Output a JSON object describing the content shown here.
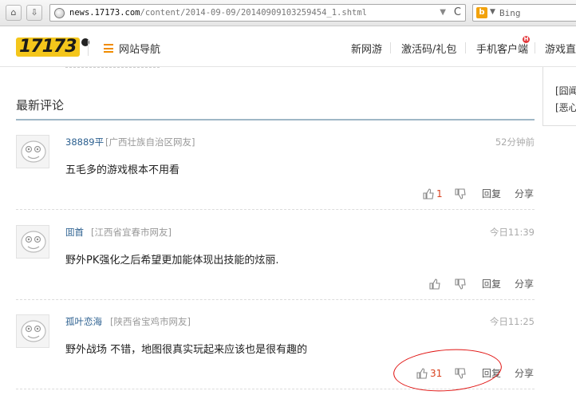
{
  "browser": {
    "url_host": "news.17173.com",
    "url_path": "/content/2014-09-09/20140909103259454_1.shtml",
    "search_engine": "Bing",
    "search_arrow": "▼",
    "reload_glyph": "C"
  },
  "header": {
    "logo_text": "17173",
    "nav_menu_label": "网站导航",
    "links": [
      "新网游",
      "激活码/礼包",
      "手机客户端",
      "游戏直达"
    ],
    "badge": "H"
  },
  "side_panel": {
    "items": [
      "[囧闻",
      "[恶心"
    ]
  },
  "comments_section": {
    "title": "最新评论",
    "reply_label": "回复",
    "share_label": "分享",
    "comments": [
      {
        "user": "38889平",
        "location": "[广西壮族自治区网友]",
        "time": "52分钟前",
        "text": "五毛多的游戏根本不用看",
        "likes": "1"
      },
      {
        "user": "囬首",
        "location": "[江西省宜春市网友]",
        "time": "今日11:39",
        "text": "野外PK强化之后希望更加能体现出技能的炫丽.",
        "likes": ""
      },
      {
        "user": "孤叶恋海",
        "location": "[陕西省宝鸡市网友]",
        "time": "今日11:25",
        "text": "野外战场  不错，地图很真实玩起来应该也是很有趣的",
        "likes": "31"
      }
    ]
  },
  "colors": {
    "accent_orange": "#f08c00",
    "username_blue": "#2b5f8f",
    "like_red": "#d9411e",
    "annotation_red": "#e0100e",
    "section_rule": "#9fb7c6"
  }
}
